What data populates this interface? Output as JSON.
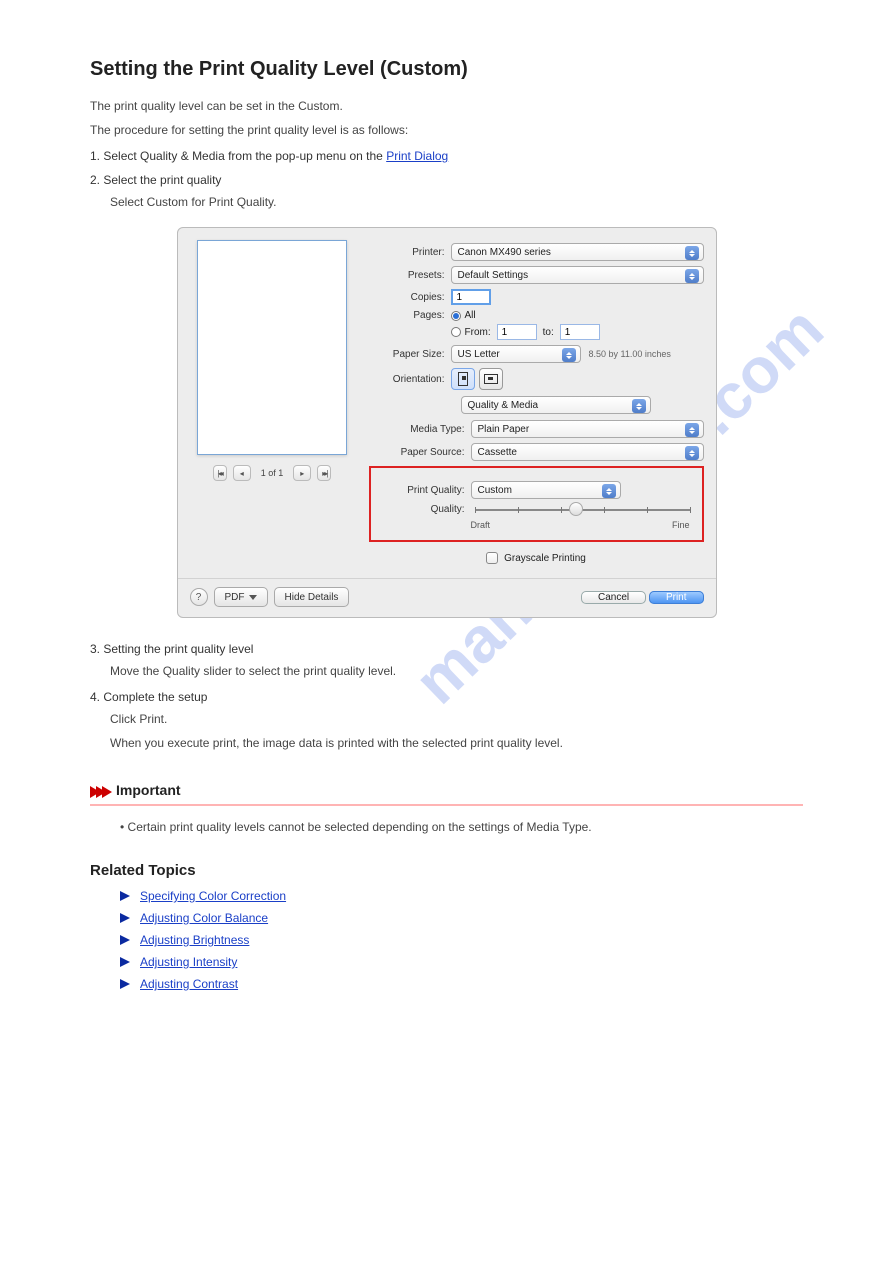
{
  "title": "Setting the Print Quality Level (Custom)",
  "intro": "The print quality level can be set in the Custom.",
  "procTitle": "The procedure for setting the print quality level is as follows:",
  "steps": [
    {
      "num": "1.",
      "text_a": "Select Quality & Media from the pop-up menu on the ",
      "link": "Print Dialog",
      "text_b": ""
    },
    {
      "num": "2.",
      "text_a": "Select the print quality",
      "text_b": "Select Custom for Print Quality."
    },
    {
      "num": "3.",
      "text_a": "Setting the print quality level",
      "text_b": "Move the Quality slider to select the print quality level."
    },
    {
      "num": "4.",
      "text_a": "Complete the setup",
      "text_b": "Click Print.",
      "text_c": "When you execute print, the image data is printed with the selected print quality level."
    }
  ],
  "important": {
    "label": "Important",
    "text": "Certain print quality levels cannot be selected depending on the settings of Media Type."
  },
  "related": {
    "title": "Related Topics",
    "items": [
      "Specifying Color Correction",
      "Adjusting Color Balance",
      "Adjusting Brightness",
      "Adjusting Intensity",
      "Adjusting Contrast"
    ]
  },
  "dialog": {
    "printerLabel": "Printer:",
    "printerValue": "Canon MX490 series",
    "presetsLabel": "Presets:",
    "presetsValue": "Default Settings",
    "copiesLabel": "Copies:",
    "copiesValue": "1",
    "pagesLabel": "Pages:",
    "pagesAll": "All",
    "pagesFrom": "From:",
    "pagesFromValue": "1",
    "pagesTo": "to:",
    "pagesToValue": "1",
    "paperSizeLabel": "Paper Size:",
    "paperSizeValue": "US Letter",
    "paperSizeNote": "8.50 by 11.00 inches",
    "orientationLabel": "Orientation:",
    "sectionSelect": "Quality & Media",
    "mediaTypeLabel": "Media Type:",
    "mediaTypeValue": "Plain Paper",
    "paperSourceLabel": "Paper Source:",
    "paperSourceValue": "Cassette",
    "printQualityLabel": "Print Quality:",
    "printQualityValue": "Custom",
    "qualityLabel": "Quality:",
    "qualityMin": "Draft",
    "qualityMax": "Fine",
    "grayscale": "Grayscale Printing",
    "pagerText": "1 of 1",
    "help": "?",
    "pdf": "PDF",
    "hideDetails": "Hide Details",
    "cancel": "Cancel",
    "print": "Print"
  },
  "watermark": "manualshive.com"
}
